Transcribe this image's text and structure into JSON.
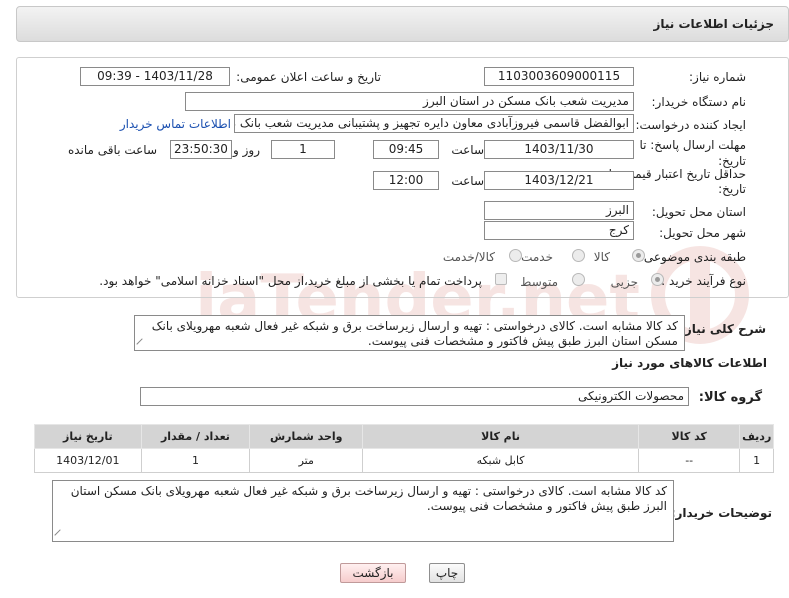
{
  "header": {
    "title": "جزئیات اطلاعات نیاز"
  },
  "form": {
    "need_number_label": "شماره نیاز:",
    "need_number": "1103003609000115",
    "announce_label": "تاریخ و ساعت اعلان عمومی:",
    "announce_value": "1403/11/28 - 09:39",
    "buyer_label": "نام دستگاه خریدار:",
    "buyer_value": "مدیریت شعب بانک مسکن در استان البرز",
    "creator_label": "ایجاد کننده درخواست:",
    "creator_value": "ابوالفضل قاسمی فیروزآبادی معاون دایره تجهیز و پشتیبانی مدیریت شعب بانک م",
    "contact_link": "اطلاعات تماس خریدار",
    "deadline_label_1": "مهلت ارسال پاسخ: تا",
    "deadline_label_2": "تاریخ:",
    "deadline_date": "1403/11/30",
    "time_label": "ساعت",
    "deadline_time": "09:45",
    "days_value": "1",
    "days_label": "روز و",
    "remaining_value": "23:50:30",
    "remaining_label": "ساعت باقی مانده",
    "validity_label_1": "حداقل تاریخ اعتبار قیمت: تا",
    "validity_label_2": "تاریخ:",
    "validity_date": "1403/12/21",
    "validity_time": "12:00",
    "province_label": "استان محل تحویل:",
    "province_value": "البرز",
    "city_label": "شهر محل تحویل:",
    "city_value": "کرج",
    "category_label": "طبقه بندی موضوعی:",
    "category_options": [
      "کالا",
      "خدمت",
      "کالا/خدمت"
    ],
    "process_label": "نوع فرآیند خرید :",
    "process_options": [
      "جزیی",
      "متوسط"
    ],
    "payment_note": "پرداخت تمام یا بخشی از مبلغ خرید،از محل \"اسناد خزانه اسلامی\" خواهد بود."
  },
  "description": {
    "label": "شرح کلی نیاز:",
    "text": "کد کالا مشابه است. کالای درخواستی : تهیه و ارسال زیرساخت برق و شبکه غیر فعال شعبه مهرویلای بانک مسکن استان البرز طبق پیش فاکتور و مشخصات فنی پیوست."
  },
  "goods": {
    "section_title": "اطلاعات کالاهای مورد نیاز",
    "group_label": "گروه کالا:",
    "group_value": "محصولات الکترونیکی",
    "columns": [
      "ردیف",
      "کد کالا",
      "نام کالا",
      "واحد شمارش",
      "تعداد / مقدار",
      "تاریخ نیاز"
    ],
    "rows": [
      [
        "1",
        "--",
        "کابل شبکه",
        "متر",
        "1",
        "1403/12/01"
      ]
    ]
  },
  "buyer_notes": {
    "label": "توضیحات خریدار:",
    "text": "کد کالا مشابه است. کالای درخواستی : تهیه و ارسال زیرساخت برق و شبکه غیر فعال شعبه مهرویلای بانک مسکن استان البرز طبق پیش فاکتور و مشخصات فنی پیوست."
  },
  "buttons": {
    "print": "چاپ",
    "back": "بازگشت"
  },
  "watermark": {
    "text": "AriaTender.net",
    "color": "#c0392b"
  }
}
